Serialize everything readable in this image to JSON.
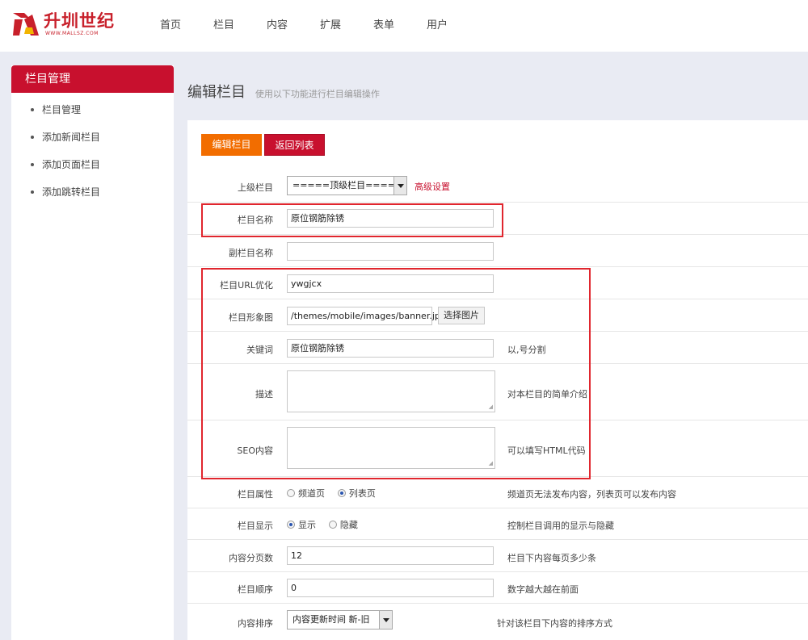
{
  "logo": {
    "name": "升圳世纪",
    "sub": "WWW.MALLSZ.COM"
  },
  "nav": [
    "首页",
    "栏目",
    "内容",
    "扩展",
    "表单",
    "用户"
  ],
  "sidebar": {
    "title": "栏目管理",
    "items": [
      "栏目管理",
      "添加新闻栏目",
      "添加页面栏目",
      "添加跳转栏目"
    ]
  },
  "header": {
    "title": "编辑栏目",
    "desc": "使用以下功能进行栏目编辑操作"
  },
  "tabs": {
    "edit": "编辑栏目",
    "back": "返回列表"
  },
  "form": {
    "parent": {
      "label": "上级栏目",
      "value": "=====顶级栏目=====",
      "advanced": "高级设置"
    },
    "name": {
      "label": "栏目名称",
      "value": "原位钢筋除锈"
    },
    "subname": {
      "label": "副栏目名称",
      "value": ""
    },
    "url": {
      "label": "栏目URL优化",
      "value": "ywgjcx"
    },
    "image": {
      "label": "栏目形象图",
      "value": "/themes/mobile/images/banner.jpg",
      "button": "选择图片"
    },
    "keywords": {
      "label": "关键词",
      "value": "原位钢筋除锈",
      "tip": "以,号分割"
    },
    "description": {
      "label": "描述",
      "value": "",
      "tip": "对本栏目的简单介绍"
    },
    "seo": {
      "label": "SEO内容",
      "value": "",
      "tip": "可以填写HTML代码"
    },
    "attr": {
      "label": "栏目属性",
      "opt1": "频道页",
      "opt2": "列表页",
      "selected": "列表页",
      "tip": "频道页无法发布内容，列表页可以发布内容"
    },
    "display": {
      "label": "栏目显示",
      "opt1": "显示",
      "opt2": "隐藏",
      "selected": "显示",
      "tip": "控制栏目调用的显示与隐藏"
    },
    "pagesize": {
      "label": "内容分页数",
      "value": "12",
      "tip": "栏目下内容每页多少条"
    },
    "order": {
      "label": "栏目顺序",
      "value": "0",
      "tip": "数字越大越在前面"
    },
    "sort": {
      "label": "内容排序",
      "value": "内容更新时间 新-旧",
      "tip": "针对该栏目下内容的排序方式"
    }
  },
  "colors": {
    "brand_red": "#c8102e",
    "orange": "#f26d00",
    "highlight": "#e0262e",
    "bg": "#e9ebf3"
  }
}
